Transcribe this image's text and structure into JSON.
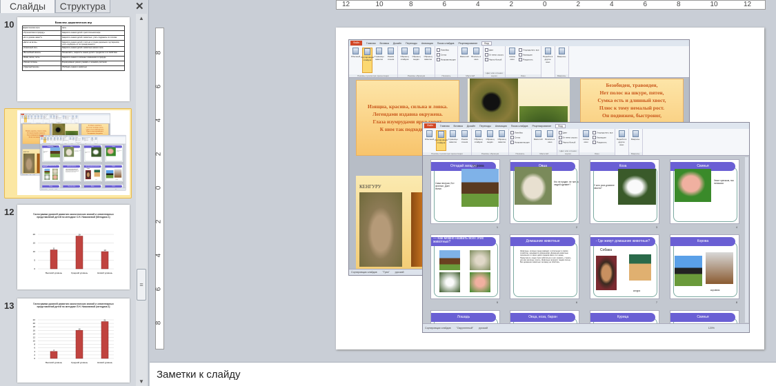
{
  "left_pane": {
    "tabs": [
      "Слайды",
      "Структура"
    ],
    "close_icon": "close-icon",
    "slide_numbers": [
      "10",
      "11",
      "12",
      "13"
    ],
    "thumb10": {
      "title": "Комплекс дидактических игр",
      "headers": [
        "Дидактическая игра",
        "Цель"
      ],
      "rows": [
        [
          "«Путешествие в природу»",
          "Закрепить знания детей о растительном мире"
        ],
        [
          "«Кто в домике живет?»",
          "Закрепить знания детей о животных, учить подражать их голосам"
        ],
        [
          "«Детки на ветке»",
          "Закрепить знания детей о листьях и плодах деревьев и кустарников, учить подбирать их по принадлежности"
        ],
        [
          "«Сказочный лес»",
          "Закрепить знания детей о животных нашего леса"
        ],
        [
          "«Волшебный мешок»",
          "Познакомить, закрепить знания детей о предметах и их свойствах"
        ],
        [
          "«Зима, весна, лето»",
          "Закрепить знания о сезонных изменениях в природе"
        ],
        [
          "«Лесная поляна»",
          "Формирование умения узнавать и называть растения"
        ],
        [
          "«Чудесный мешок»",
          "Обобщать знания о животных"
        ]
      ]
    },
    "thumb12": {
      "title": "Гистограмма уровней развития экологических знаний и элементарных представлений детей по методике С.Н. Николаевой (Методика 1)",
      "categories": [
        "Высокий уровень",
        "Средний уровень",
        "Низкий уровень"
      ],
      "values": [
        11,
        19,
        10
      ],
      "ylim": [
        0,
        20
      ],
      "ticks": [
        0,
        5,
        10,
        15,
        20
      ]
    },
    "thumb13": {
      "title": "Гистограмма уровней развития экологических знаний и элементарных представлений детей по методике Л.Н. Николаевой (методика 2)",
      "categories": [
        "Высокий уровень",
        "Средний уровень",
        "Низкий уровень"
      ],
      "values": [
        4,
        16,
        21
      ],
      "ylim": [
        0,
        22
      ],
      "ticks": [
        0,
        2,
        4,
        6,
        8,
        10,
        12,
        14,
        16,
        18,
        20,
        22
      ]
    }
  },
  "rulers": {
    "horizontal": [
      "12",
      "10",
      "8",
      "6",
      "4",
      "2",
      "0",
      "2",
      "4",
      "6",
      "8",
      "10",
      "12"
    ],
    "vertical": [
      "8",
      "6",
      "4",
      "2",
      "0",
      "2",
      "4",
      "6",
      "8"
    ]
  },
  "notes": {
    "placeholder": "Заметки к слайду"
  },
  "ppt": {
    "tabs": [
      "Файл",
      "Главная",
      "Вставка",
      "Дизайн",
      "Переходы",
      "Анимация",
      "Показ слайдов",
      "Рецензирование",
      "Вид"
    ],
    "groups": [
      {
        "label": "Режимы просмотра презентации",
        "items": [
          {
            "t": "Обычный"
          },
          {
            "t": "Сортировщик слайдов",
            "sel": true
          },
          {
            "t": "Страницы заметок"
          },
          {
            "t": "Режим чтения"
          }
        ]
      },
      {
        "label": "Режимы образцов",
        "items": [
          {
            "t": "Образец слайдов"
          },
          {
            "t": "Образец выдач"
          },
          {
            "t": "Образец заметок"
          }
        ]
      },
      {
        "label": "Показать",
        "small": [
          "Линейка",
          "Сетка",
          "Направляющие"
        ]
      },
      {
        "label": "Масштаб",
        "items": [
          {
            "t": "Масштаб"
          },
          {
            "t": "Вписать в окно"
          }
        ]
      },
      {
        "label": "Цвет или оттенки серого",
        "small": [
          "Цвет",
          "Оттенки серого",
          "Черно-белый"
        ]
      },
      {
        "label": "Окно",
        "items": [
          {
            "t": "Новое окно"
          }
        ],
        "small": [
          "Упорядочить все",
          "Каскадом",
          "Разделить"
        ]
      },
      {
        "label": "",
        "items": [
          {
            "t": "Перейти в другое окно"
          }
        ]
      },
      {
        "label": "Макросы",
        "items": [
          {
            "t": "Макросы"
          }
        ]
      }
    ],
    "status": [
      "Сортировщик слайдов",
      "\"Трек\"",
      "русский"
    ],
    "status2": [
      "Сортировщик слайдов",
      "\"Округленный\"",
      "русский"
    ],
    "zoom": "120%"
  },
  "shot1": {
    "poem_left": [
      "Изящна, красива, сильна и ловка.",
      "Легендами издавна окружена.",
      "Глаза изумрудами ярко горят.",
      "К ним так подходит обл"
    ],
    "poem_right": [
      "Безобиден, травояден,",
      "Нет полос на шкуре, пятен,",
      "Сумка есть и длинный хвост,",
      "Плюс к тому немалый рост.",
      "Он подвижен, быстроног,"
    ],
    "kangaroo_title": "КЕНГУРУ"
  },
  "cards": [
    {
      "n": "1",
      "title": "Отгадай загадки",
      "caption": "Корова",
      "text": "Сама пестрая, Ест зеленое, Дает белое."
    },
    {
      "n": "2",
      "title": "Овца",
      "text": "Кто не прядет, не ткет, а людей одевает?"
    },
    {
      "n": "3",
      "title": "Коза",
      "text": "У кого рога длиннее хвоста?"
    },
    {
      "n": "4",
      "title": "Свинья",
      "text": "Хвост крючком, нос пятачком."
    },
    {
      "n": "5",
      "title": "— Как можно назвать всех этих животных?"
    },
    {
      "n": "6",
      "title": "Домашние животные",
      "text": "Животные, которых люди разводят и используют в своём хозяйстве, называются домашними. Домашние животные произошли от своих диких предков много лет назад. Приручив их, люди стали заботиться о них: кормить, строить для них жилища, лечить. Животные приносят людям пользу. Без домашних животных человеку не обойтись."
    },
    {
      "n": "7",
      "title": "- Где живут домашние животные?",
      "caption": "Собака",
      "text": "конура"
    },
    {
      "n": "8",
      "title": "Корова",
      "text": "коровник"
    },
    {
      "n": "9",
      "title": "Лошадь"
    },
    {
      "n": "10",
      "title": "Овца, коза, баран"
    },
    {
      "n": "11",
      "title": "Курица"
    },
    {
      "n": "12",
      "title": "Свинья"
    }
  ]
}
